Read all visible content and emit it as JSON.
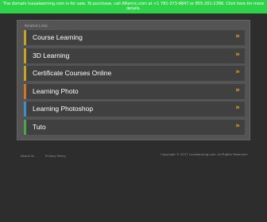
{
  "banner": {
    "text": "The domain luxoalearning.com is for sale. To purchase, call Afternic.com at +1 781-373-6847 or 855-201-2286. Click here for more details."
  },
  "panel": {
    "heading": "Related Links",
    "links": [
      {
        "label": "Course Learning",
        "arrow": "»",
        "accent": "#c9a227"
      },
      {
        "label": "3D Learning",
        "arrow": "»",
        "accent": "#c9a227"
      },
      {
        "label": "Certificate Courses Online",
        "arrow": "»",
        "accent": "#c9a227"
      },
      {
        "label": "Learning Photo",
        "arrow": "»",
        "accent": "#d4742a"
      },
      {
        "label": "Learning Photoshop",
        "arrow": "»",
        "accent": "#3b8fcc"
      },
      {
        "label": "Tuto",
        "arrow": "»",
        "accent": "#4aa84a"
      }
    ]
  },
  "footer": {
    "about": "About Us",
    "privacy": "Privacy Policy",
    "copyright": "Copyright © 2017 Luxolearning.com. All Rights Reserved."
  },
  "colors": {
    "background": "#2d2d2d",
    "banner": "#2fd34a",
    "panel": "#545454",
    "link_row": "#404040",
    "arrow": "#f0a818"
  }
}
